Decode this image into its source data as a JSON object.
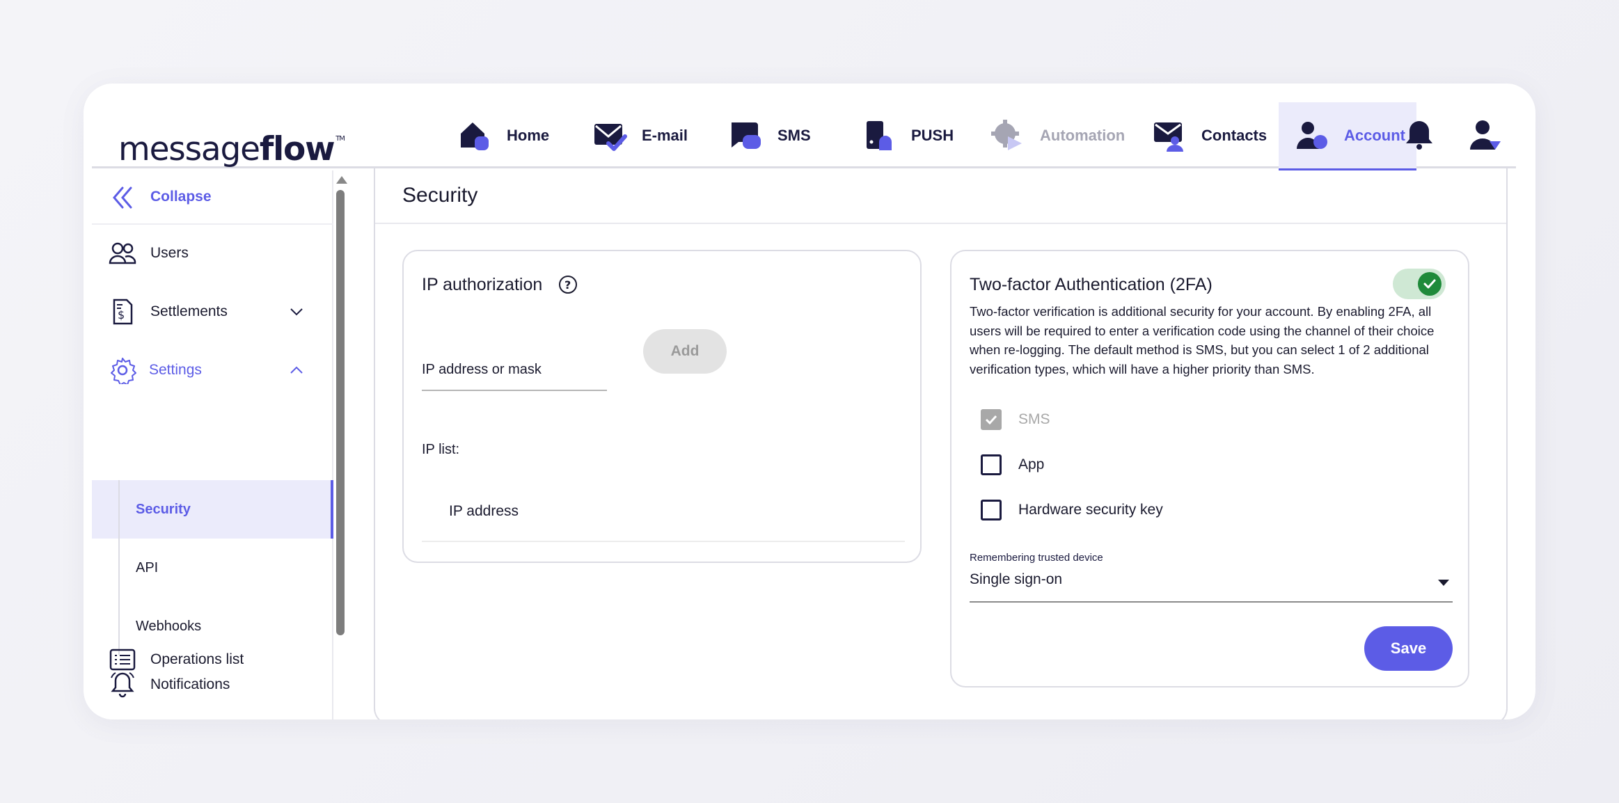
{
  "brand": {
    "logo_light": "message",
    "logo_bold": "flow",
    "logo_tm": "TM"
  },
  "nav": {
    "home": "Home",
    "email": "E-mail",
    "sms": "SMS",
    "push": "PUSH",
    "automation": "Automation",
    "contacts": "Contacts",
    "account": "Account"
  },
  "top_icons": {
    "notifications": "bell-icon",
    "profile": "user-icon"
  },
  "sidebar": {
    "collapse": "Collapse",
    "users": "Users",
    "settlements": "Settlements",
    "settings": "Settings",
    "sub_items": {
      "security": "Security",
      "api": "API",
      "webhooks": "Webhooks"
    },
    "notifications": "Notifications",
    "operations": "Operations list"
  },
  "page": {
    "title": "Security"
  },
  "ip_card": {
    "title": "IP authorization",
    "input_label": "IP address or mask",
    "add_button": "Add",
    "list_label": "IP list:",
    "column_header": "IP address"
  },
  "twofa_card": {
    "title": "Two-factor Authentication (2FA)",
    "enabled": true,
    "description": "Two-factor verification is additional security for your account. By enabling 2FA, all users will be required to enter a verification code using the channel of their choice when re-logging. The default method is SMS, but you can select 1 of 2 additional verification types, which will have a higher priority than SMS.",
    "options": [
      {
        "label": "SMS",
        "checked": true,
        "disabled": true
      },
      {
        "label": "App",
        "checked": false,
        "disabled": false
      },
      {
        "label": "Hardware security key",
        "checked": false,
        "disabled": false
      }
    ],
    "select_label": "Remembering trusted device",
    "select_value": "Single sign-on",
    "save_button": "Save"
  },
  "colors": {
    "accent": "#5c5ce6",
    "accent_bg": "#ebebfb",
    "navy": "#1a1a3f",
    "success": "#1f8a3a"
  }
}
